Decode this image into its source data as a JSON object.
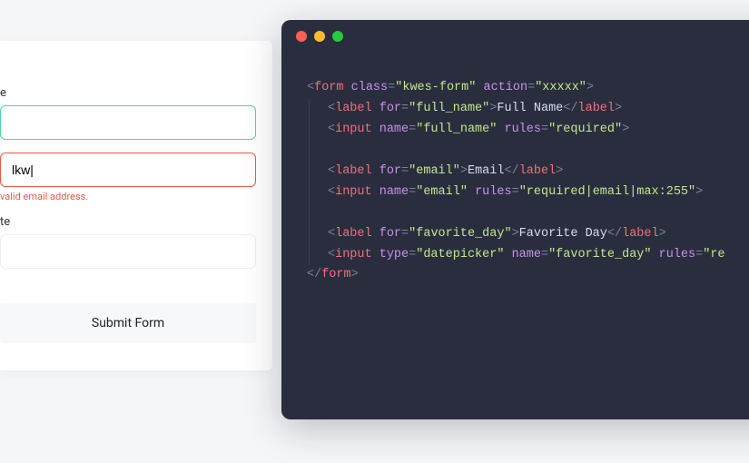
{
  "form": {
    "full_name": {
      "label": "e",
      "value": ""
    },
    "email": {
      "value": "lkw|",
      "error": "valid email address."
    },
    "favorite_day": {
      "label": "te",
      "value": ""
    },
    "submit_label": "Submit Form"
  },
  "window": {
    "dots": [
      "red",
      "yellow",
      "green"
    ]
  },
  "code": {
    "lines": [
      {
        "indent": 0,
        "tokens": [
          {
            "t": "<",
            "c": "c-punc"
          },
          {
            "t": "form ",
            "c": "c-tag"
          },
          {
            "t": "class",
            "c": "c-attr"
          },
          {
            "t": "=",
            "c": "c-punc"
          },
          {
            "t": "\"kwes-form\"",
            "c": "c-str"
          },
          {
            "t": " ",
            "c": "c-punc"
          },
          {
            "t": "action",
            "c": "c-attr"
          },
          {
            "t": "=",
            "c": "c-punc"
          },
          {
            "t": "\"xxxxx\"",
            "c": "c-str"
          },
          {
            "t": ">",
            "c": "c-punc"
          }
        ]
      },
      {
        "indent": 1,
        "tokens": [
          {
            "t": "<",
            "c": "c-punc"
          },
          {
            "t": "label ",
            "c": "c-tag"
          },
          {
            "t": "for",
            "c": "c-attr"
          },
          {
            "t": "=",
            "c": "c-punc"
          },
          {
            "t": "\"full_name\"",
            "c": "c-str"
          },
          {
            "t": ">",
            "c": "c-punc"
          },
          {
            "t": "Full Name",
            "c": "c-text"
          },
          {
            "t": "</",
            "c": "c-punc"
          },
          {
            "t": "label",
            "c": "c-tag"
          },
          {
            "t": ">",
            "c": "c-punc"
          }
        ]
      },
      {
        "indent": 1,
        "tokens": [
          {
            "t": "<",
            "c": "c-punc"
          },
          {
            "t": "input ",
            "c": "c-tag"
          },
          {
            "t": "name",
            "c": "c-attr"
          },
          {
            "t": "=",
            "c": "c-punc"
          },
          {
            "t": "\"full_name\"",
            "c": "c-str"
          },
          {
            "t": " ",
            "c": "c-punc"
          },
          {
            "t": "rules",
            "c": "c-attr"
          },
          {
            "t": "=",
            "c": "c-punc"
          },
          {
            "t": "\"required\"",
            "c": "c-str"
          },
          {
            "t": ">",
            "c": "c-punc"
          }
        ]
      },
      {
        "indent": 1,
        "blank": true
      },
      {
        "indent": 1,
        "tokens": [
          {
            "t": "<",
            "c": "c-punc"
          },
          {
            "t": "label ",
            "c": "c-tag"
          },
          {
            "t": "for",
            "c": "c-attr"
          },
          {
            "t": "=",
            "c": "c-punc"
          },
          {
            "t": "\"email\"",
            "c": "c-str"
          },
          {
            "t": ">",
            "c": "c-punc"
          },
          {
            "t": "Email",
            "c": "c-text"
          },
          {
            "t": "</",
            "c": "c-punc"
          },
          {
            "t": "label",
            "c": "c-tag"
          },
          {
            "t": ">",
            "c": "c-punc"
          }
        ]
      },
      {
        "indent": 1,
        "tokens": [
          {
            "t": "<",
            "c": "c-punc"
          },
          {
            "t": "input ",
            "c": "c-tag"
          },
          {
            "t": "name",
            "c": "c-attr"
          },
          {
            "t": "=",
            "c": "c-punc"
          },
          {
            "t": "\"email\"",
            "c": "c-str"
          },
          {
            "t": " ",
            "c": "c-punc"
          },
          {
            "t": "rules",
            "c": "c-attr"
          },
          {
            "t": "=",
            "c": "c-punc"
          },
          {
            "t": "\"required|email|max:255\"",
            "c": "c-str"
          },
          {
            "t": ">",
            "c": "c-punc"
          }
        ]
      },
      {
        "indent": 1,
        "blank": true
      },
      {
        "indent": 1,
        "tokens": [
          {
            "t": "<",
            "c": "c-punc"
          },
          {
            "t": "label ",
            "c": "c-tag"
          },
          {
            "t": "for",
            "c": "c-attr"
          },
          {
            "t": "=",
            "c": "c-punc"
          },
          {
            "t": "\"favorite_day\"",
            "c": "c-str"
          },
          {
            "t": ">",
            "c": "c-punc"
          },
          {
            "t": "Favorite Day",
            "c": "c-text"
          },
          {
            "t": "</",
            "c": "c-punc"
          },
          {
            "t": "label",
            "c": "c-tag"
          },
          {
            "t": ">",
            "c": "c-punc"
          }
        ]
      },
      {
        "indent": 1,
        "tokens": [
          {
            "t": "<",
            "c": "c-punc"
          },
          {
            "t": "input ",
            "c": "c-tag"
          },
          {
            "t": "type",
            "c": "c-attr"
          },
          {
            "t": "=",
            "c": "c-punc"
          },
          {
            "t": "\"datepicker\"",
            "c": "c-str"
          },
          {
            "t": " ",
            "c": "c-punc"
          },
          {
            "t": "name",
            "c": "c-attr"
          },
          {
            "t": "=",
            "c": "c-punc"
          },
          {
            "t": "\"favorite_day\"",
            "c": "c-str"
          },
          {
            "t": " ",
            "c": "c-punc"
          },
          {
            "t": "rules",
            "c": "c-attr"
          },
          {
            "t": "=",
            "c": "c-punc"
          },
          {
            "t": "\"re",
            "c": "c-str"
          }
        ]
      },
      {
        "indent": 0,
        "tokens": [
          {
            "t": "</",
            "c": "c-punc"
          },
          {
            "t": "form",
            "c": "c-tag"
          },
          {
            "t": ">",
            "c": "c-punc"
          }
        ]
      }
    ]
  }
}
